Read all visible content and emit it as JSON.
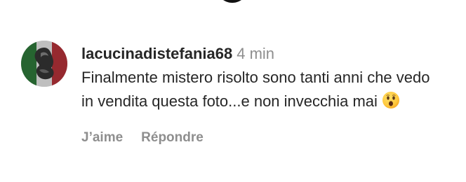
{
  "comment": {
    "username": "lacucinadistefania68",
    "time": "4 min",
    "text": "Finalmente mistero risolto sono tanti anni che vedo in vendita questa foto...e non invecchia mai",
    "emoji_icon": "astonished-face-emoji",
    "avatar_icon": "user-avatar-italian-flag"
  },
  "actions": {
    "like_label": "J’aime",
    "reply_label": "Répondre"
  },
  "colors": {
    "text": "#262626",
    "muted": "#8e8e8e",
    "flag_green": "#2f7a3b",
    "flag_red": "#b8333a"
  }
}
